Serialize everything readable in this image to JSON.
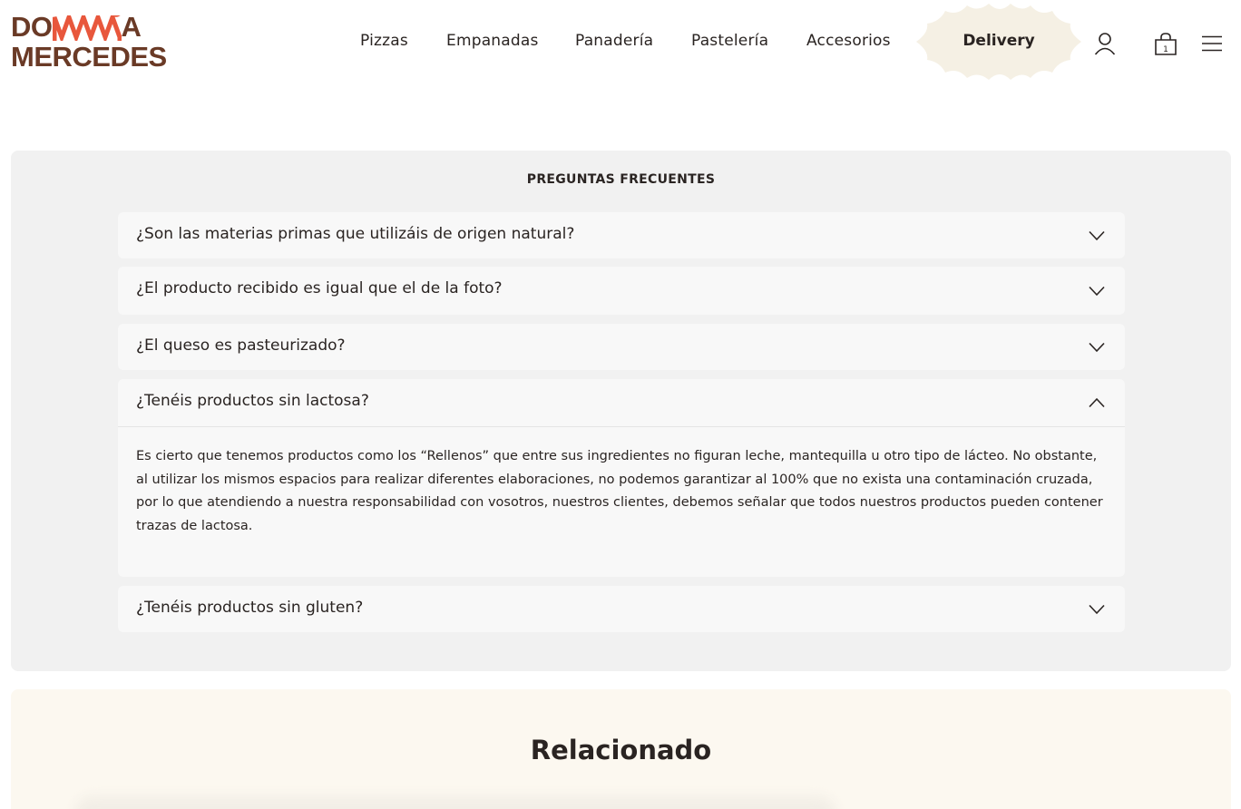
{
  "brand": {
    "line1_start": "DO",
    "line1_end": "A",
    "line2": "MERCEDES",
    "colors": {
      "primary": "#6a3a26",
      "accent": "#e8573c"
    }
  },
  "nav": {
    "items": [
      "Pizzas",
      "Empanadas",
      "Panadería",
      "Pastelería",
      "Accesorios"
    ],
    "delivery": "Delivery",
    "account_icon": "user-icon",
    "cart_icon": "shopping-bag-icon",
    "cart_count": "1",
    "menu_icon": "hamburger-menu-icon"
  },
  "faq": {
    "title": "PREGUNTAS FRECUENTES",
    "items": [
      {
        "question": "¿Son las materias primas que utilizáis de origen natural?",
        "expanded": false
      },
      {
        "question": "¿El producto recibido es igual que el de la foto?",
        "expanded": false
      },
      {
        "question": "¿El queso es pasteurizado?",
        "expanded": false
      },
      {
        "question": "¿Tenéis productos sin lactosa?",
        "expanded": true,
        "answer": "Es cierto que tenemos productos como los “Rellenos” que entre sus ingredientes no figuran leche, mantequilla u otro tipo de lácteo. No obstante, al utilizar los mismos espacios para realizar diferentes elaboraciones, no podemos garantizar al 100% que no exista una contaminación cruzada, por lo que atendiendo a nuestra responsabilidad con vosotros, nuestros clientes, debemos señalar que todos nuestros productos pueden contener trazas de lactosa."
      },
      {
        "question": "¿Tenéis productos sin gluten?",
        "expanded": false
      }
    ]
  },
  "related": {
    "title": "Relacionado"
  }
}
